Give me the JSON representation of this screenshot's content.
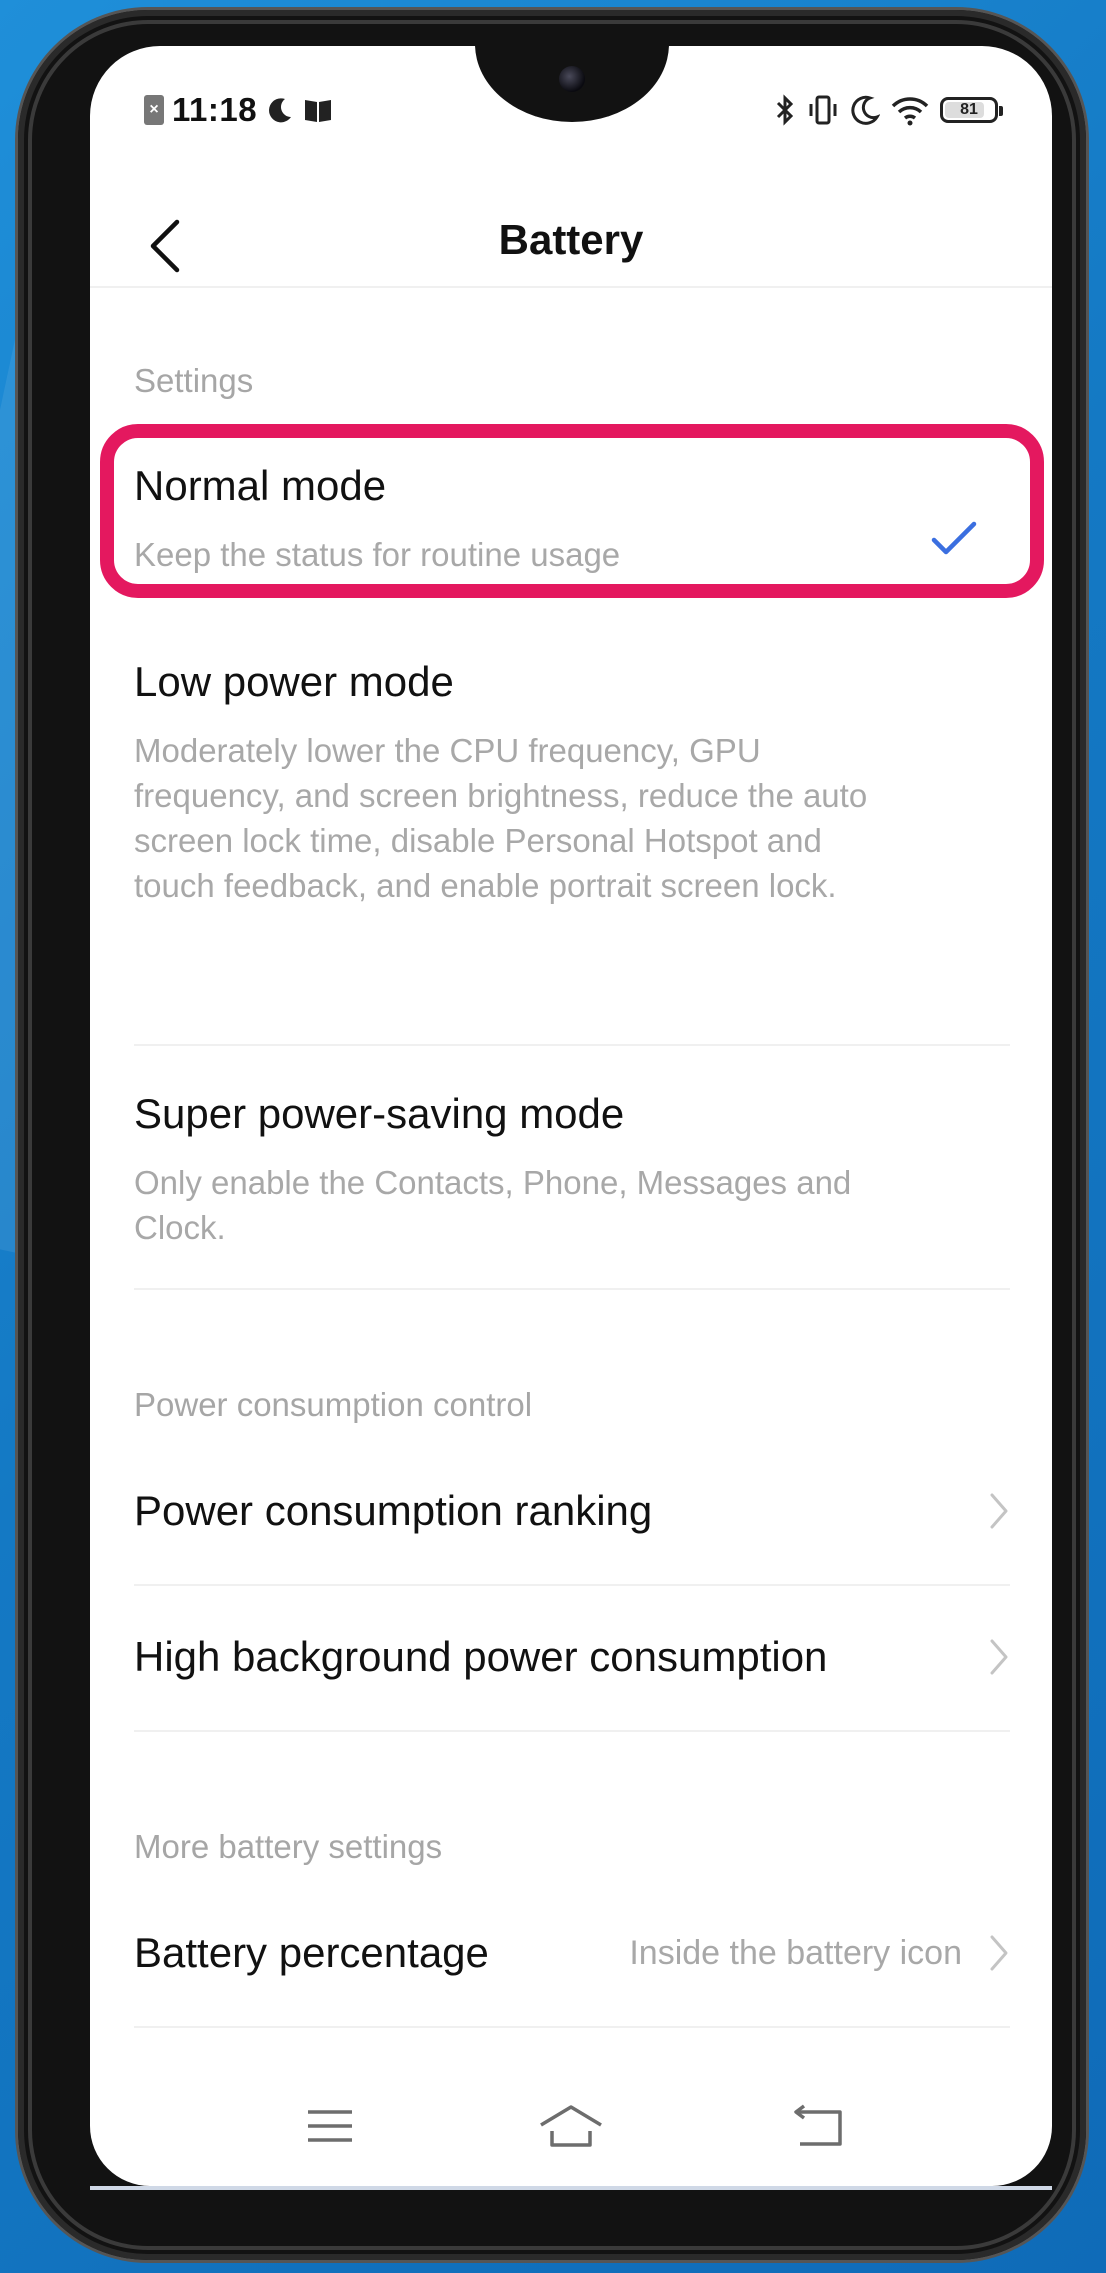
{
  "status_bar": {
    "time": "11:18",
    "battery_level": "81",
    "battery_fraction": 0.81
  },
  "header": {
    "title": "Battery"
  },
  "settings": {
    "section_label": "Settings",
    "modes": [
      {
        "title": "Normal mode",
        "description": "Keep the status for routine usage",
        "selected": true
      },
      {
        "title": "Low power mode",
        "description": "Moderately lower the CPU frequency, GPU frequency, and screen brightness, reduce the auto screen lock time, disable Personal Hotspot and touch feedback, and enable portrait screen lock.",
        "selected": false
      },
      {
        "title": "Super power-saving mode",
        "description": "Only enable the Contacts, Phone, Messages and Clock.",
        "selected": false
      }
    ]
  },
  "power_control": {
    "section_label": "Power consumption control",
    "items": [
      {
        "label": "Power consumption ranking"
      },
      {
        "label": "High background power consumption"
      }
    ]
  },
  "more_settings": {
    "section_label": "More battery settings",
    "items": [
      {
        "label": "Battery percentage",
        "value": "Inside the battery icon"
      }
    ]
  },
  "colors": {
    "highlight": "#e4185f",
    "check_accent": "#3b6fe0",
    "background": "#1479c4"
  },
  "icons": {
    "back": "back-arrow-icon",
    "check": "checkmark-icon",
    "chevron": "chevron-right-icon",
    "menu": "menu-icon",
    "home": "home-icon",
    "return": "return-icon"
  }
}
